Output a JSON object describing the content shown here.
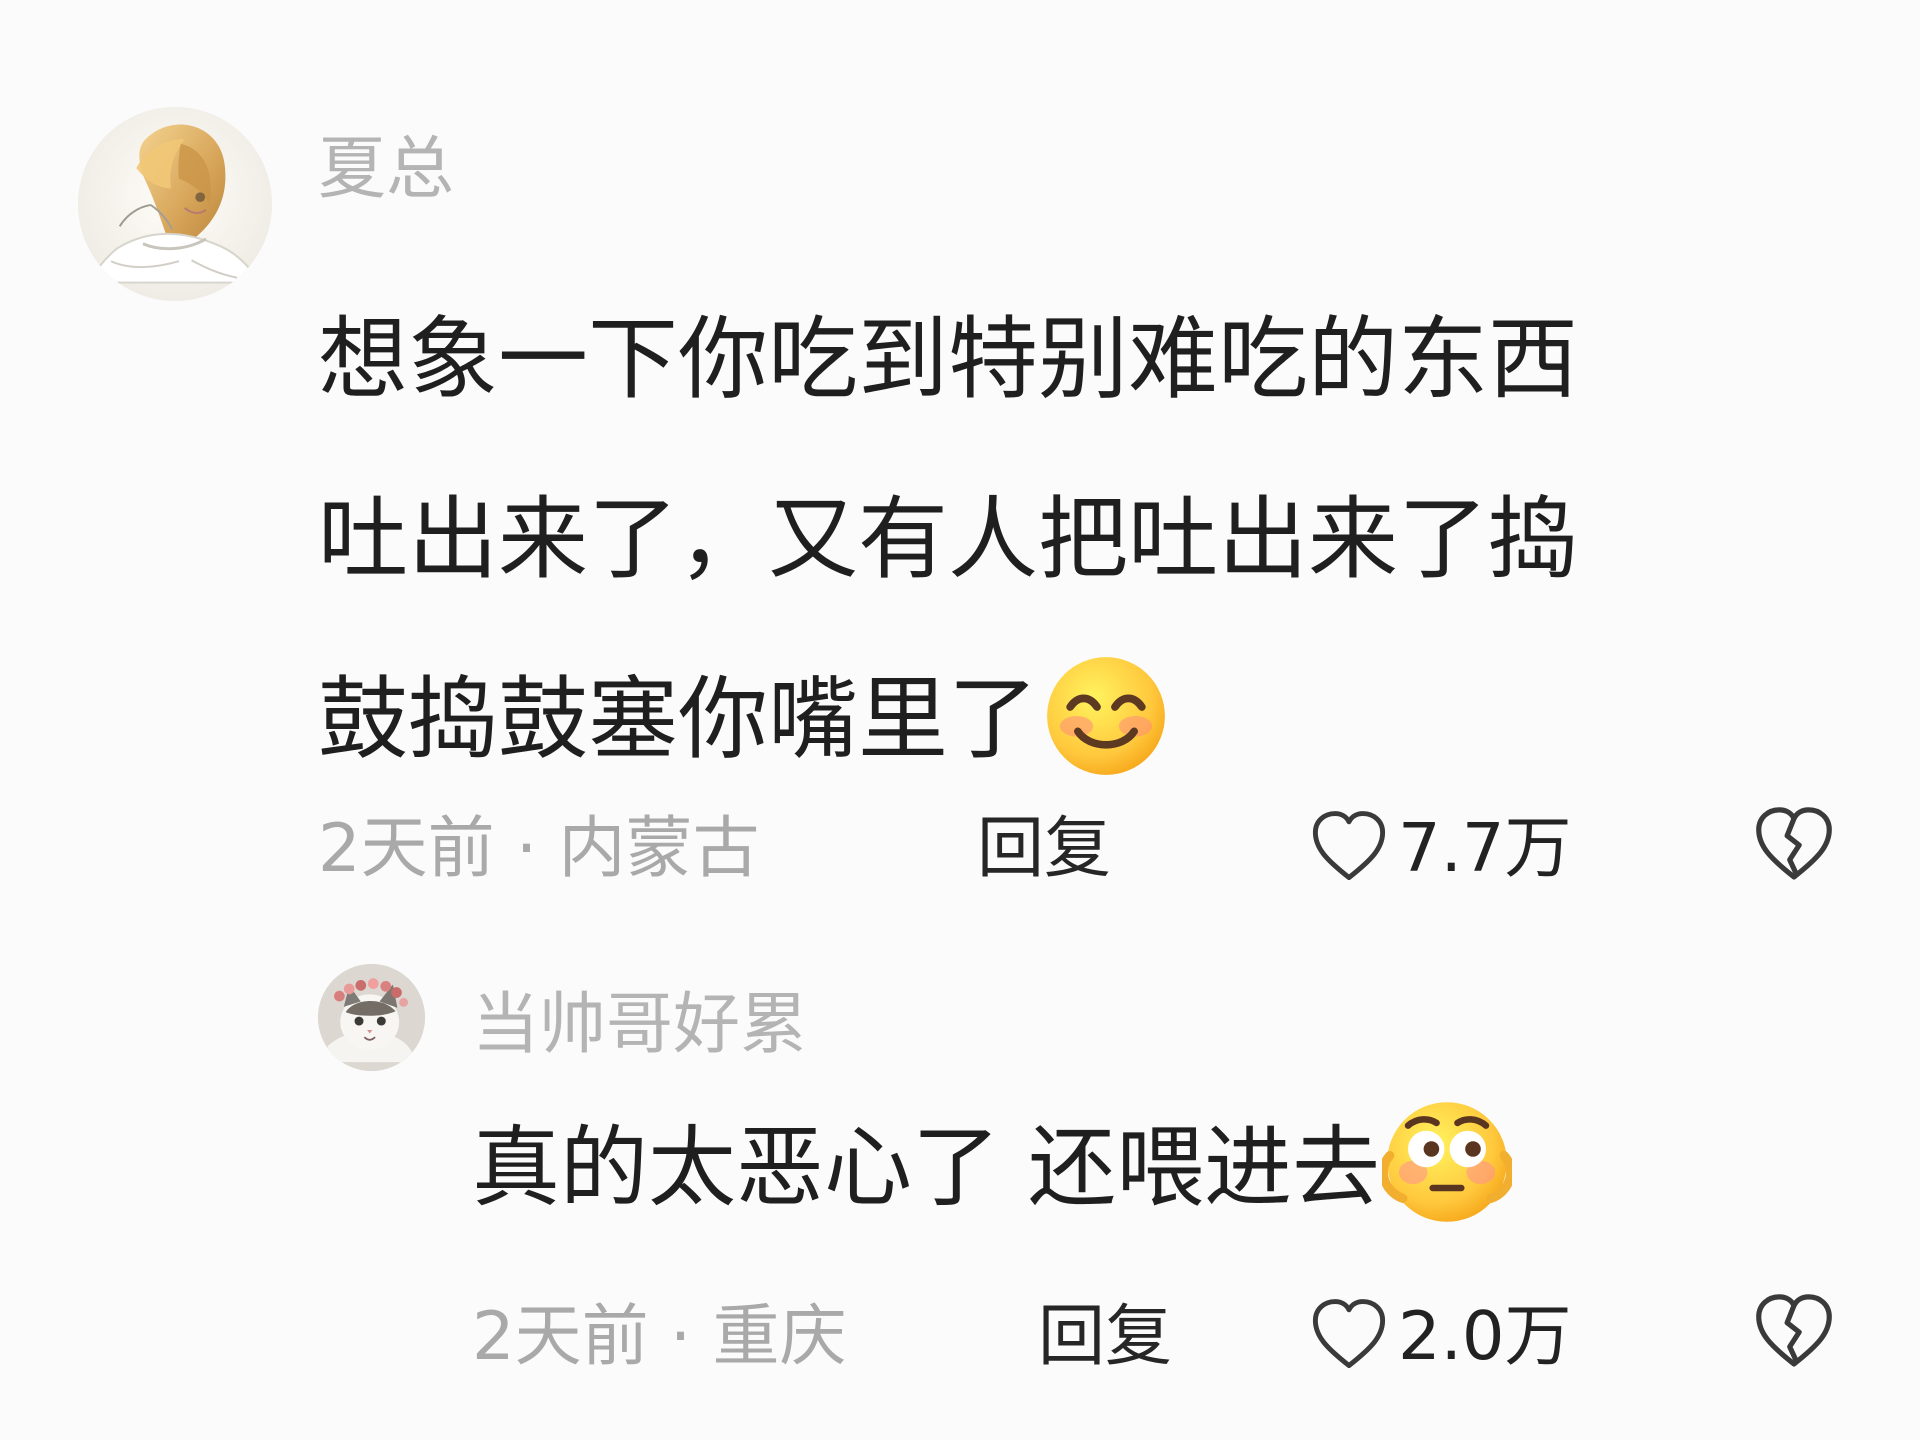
{
  "comments": [
    {
      "username": "夏总",
      "content_lines": [
        "想象一下你吃到特别难吃的东西",
        "吐出来了，又有人把吐出来了捣",
        "鼓捣鼓塞你嘴里了"
      ],
      "emoji": "smile-emoji",
      "meta": "2天前 · 内蒙古",
      "reply_label": "回复",
      "likes": "7.7万",
      "icons": {
        "like": "heart-outline-icon",
        "dislike": "broken-heart-icon"
      }
    },
    {
      "username": "当帅哥好累",
      "content": "真的太恶心了 还喂进去",
      "emoji": "flushed-emoji",
      "meta": "2天前 · 重庆",
      "reply_label": "回复",
      "likes": "2.0万",
      "icons": {
        "like": "heart-outline-icon",
        "dislike": "broken-heart-icon"
      }
    }
  ],
  "colors": {
    "background": "#fbfbfb",
    "primary_text": "#1f1f1f",
    "secondary_text": "#b4b4b4",
    "icon": "#222222"
  }
}
